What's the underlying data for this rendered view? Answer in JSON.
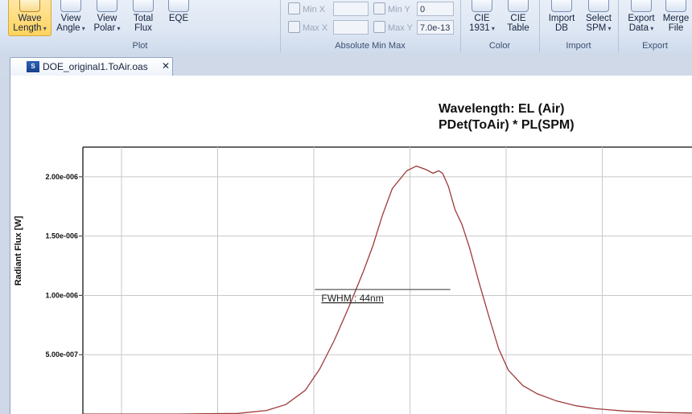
{
  "ribbon": {
    "plot_group": {
      "label": "Plot",
      "buttons": [
        {
          "line1": "Wave",
          "line2": "Length",
          "dropdown": true,
          "active": true
        },
        {
          "line1": "View",
          "line2": "Angle",
          "dropdown": true
        },
        {
          "line1": "View",
          "line2": "Polar",
          "dropdown": true
        },
        {
          "line1": "Total",
          "line2": "Flux",
          "dropdown": false
        },
        {
          "line1": "EQE",
          "line2": "",
          "dropdown": false
        }
      ]
    },
    "minmax_group": {
      "label": "Absolute Min Max",
      "min_x_label": "Min X",
      "max_x_label": "Max X",
      "min_y_label": "Min Y",
      "max_y_label": "Max Y",
      "min_x_value": "",
      "max_x_value": "",
      "min_y_value": "0",
      "max_y_value": "7.0e-13"
    },
    "color_group": {
      "label": "Color",
      "buttons": [
        {
          "line1": "CIE",
          "line2": "1931",
          "dropdown": true
        },
        {
          "line1": "CIE",
          "line2": "Table",
          "dropdown": false
        }
      ]
    },
    "import_group": {
      "label": "Import",
      "buttons": [
        {
          "line1": "Import",
          "line2": "DB",
          "dropdown": false
        },
        {
          "line1": "Select",
          "line2": "SPM",
          "dropdown": true
        }
      ]
    },
    "export_group": {
      "label": "Export",
      "buttons": [
        {
          "line1": "Export",
          "line2": "Data",
          "dropdown": true
        },
        {
          "line1": "Merge",
          "line2": "File",
          "dropdown": false
        }
      ]
    }
  },
  "document_tab": {
    "icon_text": "S",
    "name": "DOE_original1.ToAir.oas",
    "close": "✕"
  },
  "chart": {
    "title_line1": "Wavelength: EL (Air)",
    "title_line2": "PDet(ToAir) * PL(SPM)",
    "ylabel": "Radiant Flux [W]",
    "fwhm_label": "FWHM : 44nm",
    "line_color": "#9e3a3a"
  },
  "chart_data": {
    "type": "line",
    "title": "Wavelength: EL (Air) / PDet(ToAir) * PL(SPM)",
    "xlabel": "",
    "ylabel": "Radiant Flux [W]",
    "ytick_labels": [
      "5.00e-007",
      "1.00e-006",
      "1.50e-006",
      "2.00e-006"
    ],
    "yticks": [
      5e-07,
      1e-06,
      1.5e-06,
      2e-06
    ],
    "ylim": [
      0,
      2.25e-06
    ],
    "xlim": [
      0,
      6.3
    ],
    "x_grid_count": 6,
    "grid": true,
    "series": [
      {
        "values_x": [
          0.0,
          1.0,
          1.6,
          1.9,
          2.1,
          2.3,
          2.45,
          2.6,
          2.75,
          2.9,
          3.0,
          3.1,
          3.2,
          3.35,
          3.45,
          3.55,
          3.62,
          3.68,
          3.72,
          3.78,
          3.85,
          3.92,
          4.0,
          4.1,
          4.2,
          4.3,
          4.4,
          4.55,
          4.7,
          4.9,
          5.1,
          5.3,
          5.6,
          6.0,
          6.3
        ],
        "values_y": [
          0.0,
          0.0,
          5e-09,
          3e-08,
          8e-08,
          2e-07,
          3.8e-07,
          6.2e-07,
          9e-07,
          1.2e-06,
          1.42e-06,
          1.68e-06,
          1.9e-06,
          2.05e-06,
          2.09e-06,
          2.06e-06,
          2.03e-06,
          2.05e-06,
          2.03e-06,
          1.92e-06,
          1.72e-06,
          1.6e-06,
          1.4e-06,
          1.1e-06,
          8.2e-07,
          5.5e-07,
          3.7e-07,
          2.4e-07,
          1.7e-07,
          1.1e-07,
          7e-08,
          4.5e-08,
          2.5e-08,
          1.2e-08,
          8e-09
        ]
      }
    ],
    "fwhm": {
      "x_start": 2.4,
      "x_end": 3.8,
      "y": 1.05e-06
    }
  }
}
